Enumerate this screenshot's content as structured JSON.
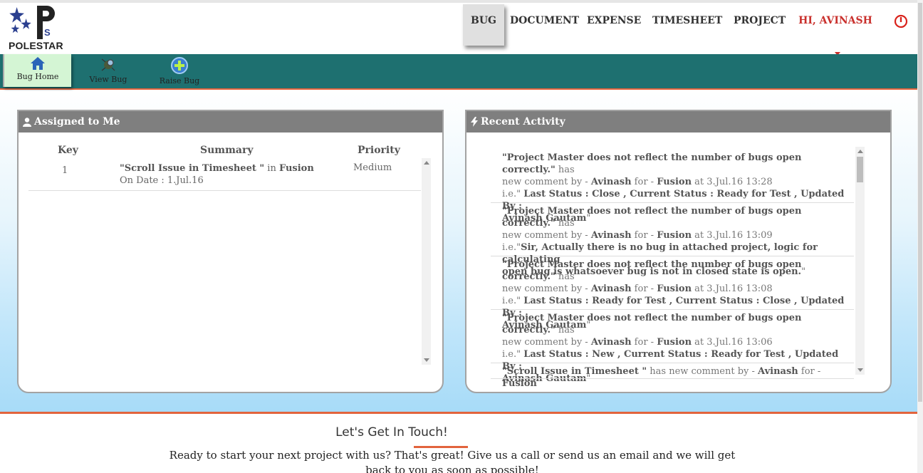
{
  "brand": {
    "name": "POLESTAR",
    "logo_letters": "PS"
  },
  "nav": {
    "items": [
      "BUG",
      "DOCUMENT",
      "EXPENSE",
      "TIMESHEET",
      "PROJECT"
    ],
    "active": "BUG",
    "user_label": "HI, AVINASH",
    "power_icon": "power-icon"
  },
  "subnav": {
    "items": [
      {
        "label": "Bug Home",
        "icon": "home-icon"
      },
      {
        "label": "View Bug",
        "icon": "view-bug-icon"
      },
      {
        "label": "Raise Bug",
        "icon": "plus-circle-icon"
      }
    ]
  },
  "assigned": {
    "title": "Assigned to Me",
    "columns": [
      "Key",
      "Summary",
      "Priority"
    ],
    "rows": [
      {
        "key": "1",
        "summary": "\"Scroll Issue in Timesheet \"",
        "in_text": "in",
        "project": "Fusion",
        "date": "On Date : 1.Jul.16",
        "priority": "Medium"
      }
    ]
  },
  "activity": {
    "title": "Recent Activity",
    "items": [
      {
        "lines": [
          [
            [
              "b",
              "\"Project Master does not reflect the number of bugs open correctly.\""
            ],
            [
              "t",
              " has"
            ]
          ],
          [
            [
              "t",
              "new comment by - "
            ],
            [
              "b",
              "Avinash"
            ],
            [
              "t",
              " for - "
            ],
            [
              "b",
              "Fusion"
            ],
            [
              "t",
              " at 3.Jul.16 13:28"
            ]
          ],
          [
            [
              "t",
              "i.e.\" "
            ],
            [
              "b",
              "Last Status : Close , Current Status : Ready for Test , Updated By :"
            ]
          ],
          [
            [
              "b",
              "Avinash Gautam"
            ],
            [
              "t",
              "\""
            ]
          ]
        ]
      },
      {
        "lines": [
          [
            [
              "b",
              "\"Project Master does not reflect the number of bugs open correctly.\""
            ],
            [
              "t",
              " has"
            ]
          ],
          [
            [
              "t",
              "new comment by - "
            ],
            [
              "b",
              "Avinash"
            ],
            [
              "t",
              " for - "
            ],
            [
              "b",
              "Fusion"
            ],
            [
              "t",
              " at 3.Jul.16 13:09"
            ]
          ],
          [
            [
              "t",
              "i.e.\""
            ],
            [
              "b",
              "Sir, Actually there is no bug in attached project, logic for calculating"
            ]
          ],
          [
            [
              "b",
              "open bug is whatsoever bug is not in closed state is open."
            ],
            [
              "t",
              "\""
            ]
          ]
        ]
      },
      {
        "lines": [
          [
            [
              "b",
              "\"Project Master does not reflect the number of bugs open correctly.\""
            ],
            [
              "t",
              " has"
            ]
          ],
          [
            [
              "t",
              "new comment by - "
            ],
            [
              "b",
              "Avinash"
            ],
            [
              "t",
              " for - "
            ],
            [
              "b",
              "Fusion"
            ],
            [
              "t",
              " at 3.Jul.16 13:08"
            ]
          ],
          [
            [
              "t",
              "i.e.\" "
            ],
            [
              "b",
              "Last Status : Ready for Test , Current Status : Close , Updated By :"
            ]
          ],
          [
            [
              "b",
              "Avinash Gautam"
            ],
            [
              "t",
              "\""
            ]
          ]
        ]
      },
      {
        "lines": [
          [
            [
              "b",
              "\"Project Master does not reflect the number of bugs open correctly.\""
            ],
            [
              "t",
              " has"
            ]
          ],
          [
            [
              "t",
              "new comment by - "
            ],
            [
              "b",
              "Avinash"
            ],
            [
              "t",
              " for - "
            ],
            [
              "b",
              "Fusion"
            ],
            [
              "t",
              " at 3.Jul.16 13:06"
            ]
          ],
          [
            [
              "t",
              "i.e.\" "
            ],
            [
              "b",
              "Last Status : New , Current Status : Ready for Test , Updated By :"
            ]
          ],
          [
            [
              "b",
              "Avinash Gautam"
            ],
            [
              "t",
              "\""
            ]
          ]
        ]
      },
      {
        "lines": [
          [
            [
              "b",
              "\"Scroll Issue in Timesheet \""
            ],
            [
              "t",
              " has new comment by - "
            ],
            [
              "b",
              "Avinash"
            ],
            [
              "t",
              " for - "
            ],
            [
              "b",
              "Fusion"
            ]
          ]
        ]
      }
    ]
  },
  "footer": {
    "title": "Let's Get In Touch!",
    "text": "Ready to start your next project with us? That's great! Give us a call or send us an email and we will get back to you as soon as possible!"
  },
  "colors": {
    "teal": "#1e7070",
    "accent": "#e2643d",
    "user_red": "#c9302c",
    "panel_header": "#7f7f7f"
  }
}
